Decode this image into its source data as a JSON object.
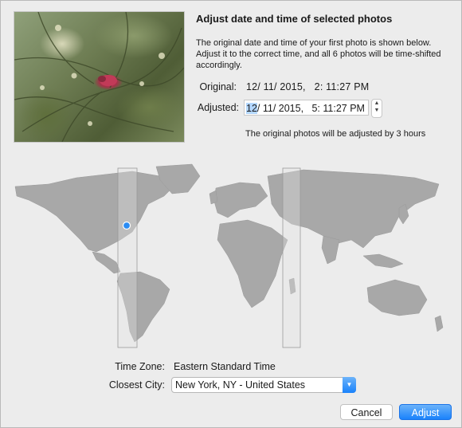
{
  "dialog": {
    "title": "Adjust date and time of selected photos",
    "description": "The original date and time of your first photo is shown below. Adjust it to the correct time, and all 6 photos will be time-shifted accordingly."
  },
  "original": {
    "label": "Original:",
    "value": "12/ 11/ 2015,   2: 11:27 PM"
  },
  "adjusted": {
    "label": "Adjusted:",
    "month": "12",
    "rest": "/ 11/ 2015,   5: 11:27 PM"
  },
  "adjust_note": "The original photos will be adjusted by 3 hours",
  "timezone": {
    "label": "Time Zone:",
    "value": "Eastern Standard Time"
  },
  "city": {
    "label": "Closest City:",
    "value": "New York, NY - United States"
  },
  "buttons": {
    "cancel": "Cancel",
    "adjust": "Adjust"
  },
  "colors": {
    "accent": "#1a82fb",
    "map_land": "#a9a9a9",
    "selection": "#b3d7ff"
  }
}
